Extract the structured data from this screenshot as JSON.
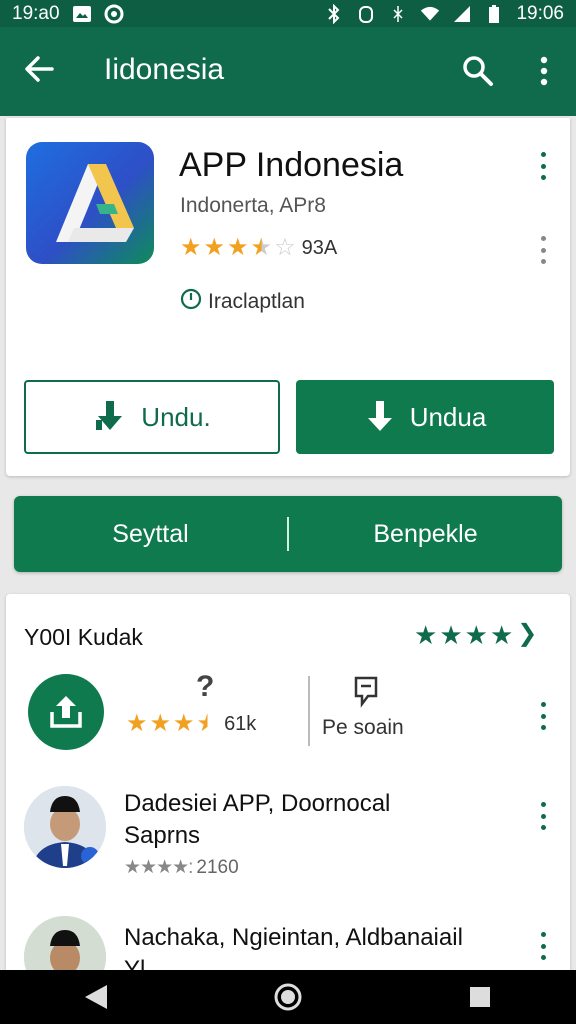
{
  "status_bar": {
    "time_left": "19:a0",
    "time_right": "19:06"
  },
  "app_bar": {
    "title": "Iidonesia"
  },
  "app": {
    "name": "APP Indonesia",
    "developer": "Indonerta, APr8",
    "rating_count": "93A",
    "rating_stars": 3.5,
    "status_text": "Iraclaptlan"
  },
  "buttons": {
    "outline_label": "Undu.",
    "filled_label": "Undua"
  },
  "tabs": {
    "left": "Seyttal",
    "right": "Benpekle"
  },
  "section": {
    "title": "Y00I Kudak",
    "question": "?",
    "count": "61k",
    "side_label": "Pe soain"
  },
  "items": [
    {
      "title_line1": "Dadesiei APP, Doornocal",
      "title_line2": "Saprns",
      "sub": "2160"
    },
    {
      "title_line1": "Nachaka, Ngieintan, Aldbanaiail",
      "title_line2": "Yl..."
    }
  ],
  "colors": {
    "primary": "#0f6b4b",
    "primary_dark": "#0d5e43",
    "star_gold": "#f2a020"
  }
}
